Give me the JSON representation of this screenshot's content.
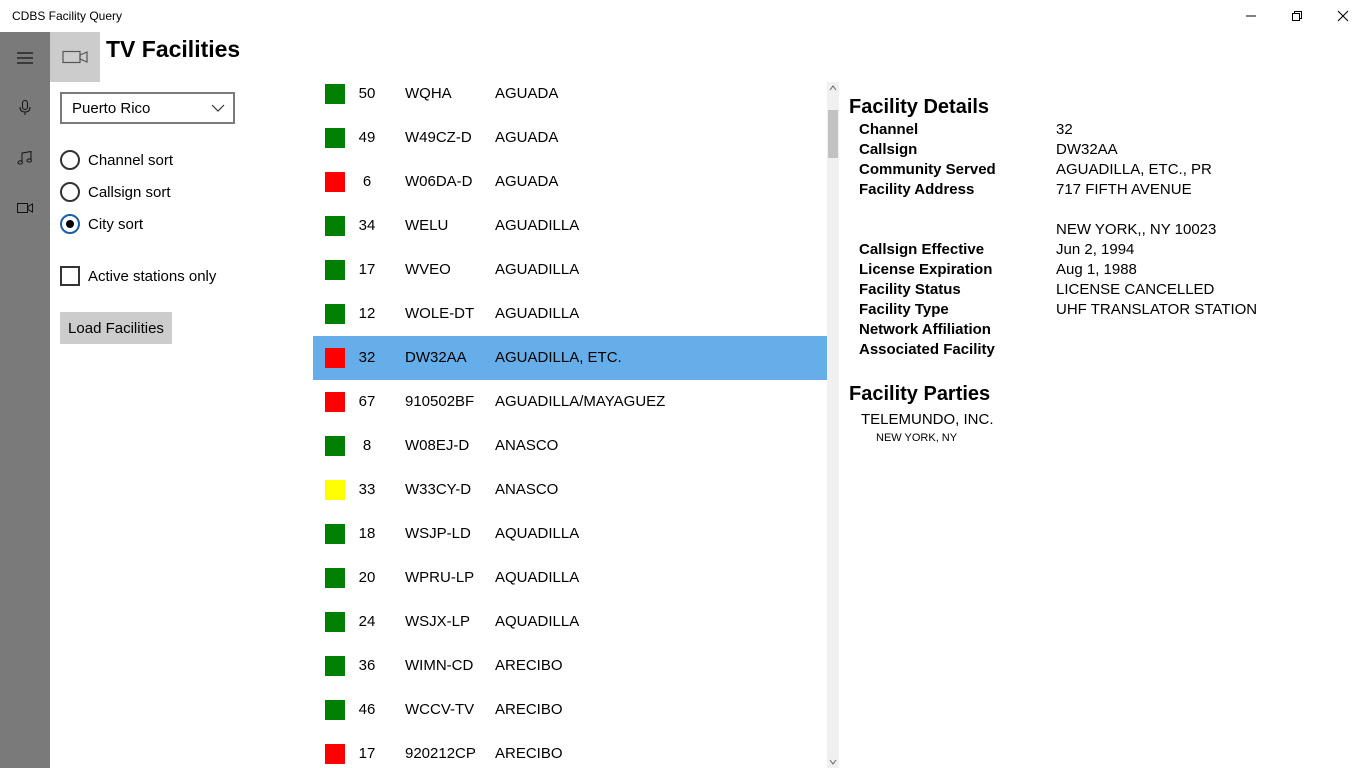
{
  "window": {
    "title": "CDBS Facility Query"
  },
  "page": {
    "title": "TV Facilities"
  },
  "state_select": {
    "value": "Puerto Rico"
  },
  "sort_options": [
    {
      "label": "Channel sort",
      "checked": false
    },
    {
      "label": "Callsign sort",
      "checked": false
    },
    {
      "label": "City sort",
      "checked": true
    }
  ],
  "active_only": {
    "label": "Active stations only",
    "checked": false
  },
  "load_button": {
    "label": "Load Facilities"
  },
  "status_colors": {
    "green": "#008000",
    "red": "#ff0000",
    "yellow": "#ffff00"
  },
  "selection_color": "#66aee9",
  "facilities": [
    {
      "status": "green",
      "channel": "50",
      "callsign": "WQHA",
      "city": "AGUADA"
    },
    {
      "status": "green",
      "channel": "49",
      "callsign": "W49CZ-D",
      "city": "AGUADA"
    },
    {
      "status": "red",
      "channel": "6",
      "callsign": "W06DA-D",
      "city": "AGUADA"
    },
    {
      "status": "green",
      "channel": "34",
      "callsign": "WELU",
      "city": "AGUADILLA"
    },
    {
      "status": "green",
      "channel": "17",
      "callsign": "WVEO",
      "city": "AGUADILLA"
    },
    {
      "status": "green",
      "channel": "12",
      "callsign": "WOLE-DT",
      "city": "AGUADILLA"
    },
    {
      "status": "red",
      "channel": "32",
      "callsign": "DW32AA",
      "city": "AGUADILLA, ETC.",
      "selected": true
    },
    {
      "status": "red",
      "channel": "67",
      "callsign": "910502BF",
      "city": "AGUADILLA/MAYAGUEZ"
    },
    {
      "status": "green",
      "channel": "8",
      "callsign": "W08EJ-D",
      "city": "ANASCO"
    },
    {
      "status": "yellow",
      "channel": "33",
      "callsign": "W33CY-D",
      "city": "ANASCO"
    },
    {
      "status": "green",
      "channel": "18",
      "callsign": "WSJP-LD",
      "city": "AQUADILLA"
    },
    {
      "status": "green",
      "channel": "20",
      "callsign": "WPRU-LP",
      "city": "AQUADILLA"
    },
    {
      "status": "green",
      "channel": "24",
      "callsign": "WSJX-LP",
      "city": "AQUADILLA"
    },
    {
      "status": "green",
      "channel": "36",
      "callsign": "WIMN-CD",
      "city": "ARECIBO"
    },
    {
      "status": "green",
      "channel": "46",
      "callsign": "WCCV-TV",
      "city": "ARECIBO"
    },
    {
      "status": "red",
      "channel": "17",
      "callsign": "920212CP",
      "city": "ARECIBO"
    }
  ],
  "details": {
    "title": "Facility Details",
    "labels": {
      "channel": "Channel",
      "callsign": "Callsign",
      "community": "Community Served",
      "address": "Facility Address",
      "callsign_effective": "Callsign Effective",
      "license_expiration": "License Expiration",
      "facility_status": "Facility Status",
      "facility_type": "Facility Type",
      "network": "Network Affiliation",
      "associated": "Associated Facility"
    },
    "values": {
      "channel": "32",
      "callsign": "DW32AA",
      "community": "AGUADILLA, ETC.,  PR",
      "address_line1": "717 FIFTH  AVENUE",
      "address_line2": "NEW YORK,, NY 10023",
      "callsign_effective": "Jun 2, 1994",
      "license_expiration": "Aug 1, 1988",
      "facility_status": "LICENSE CANCELLED",
      "facility_type": "UHF TRANSLATOR STATION"
    }
  },
  "parties": {
    "title": "Facility Parties",
    "items": [
      {
        "name": "TELEMUNDO, INC.",
        "location": "NEW YORK,  NY"
      }
    ]
  }
}
